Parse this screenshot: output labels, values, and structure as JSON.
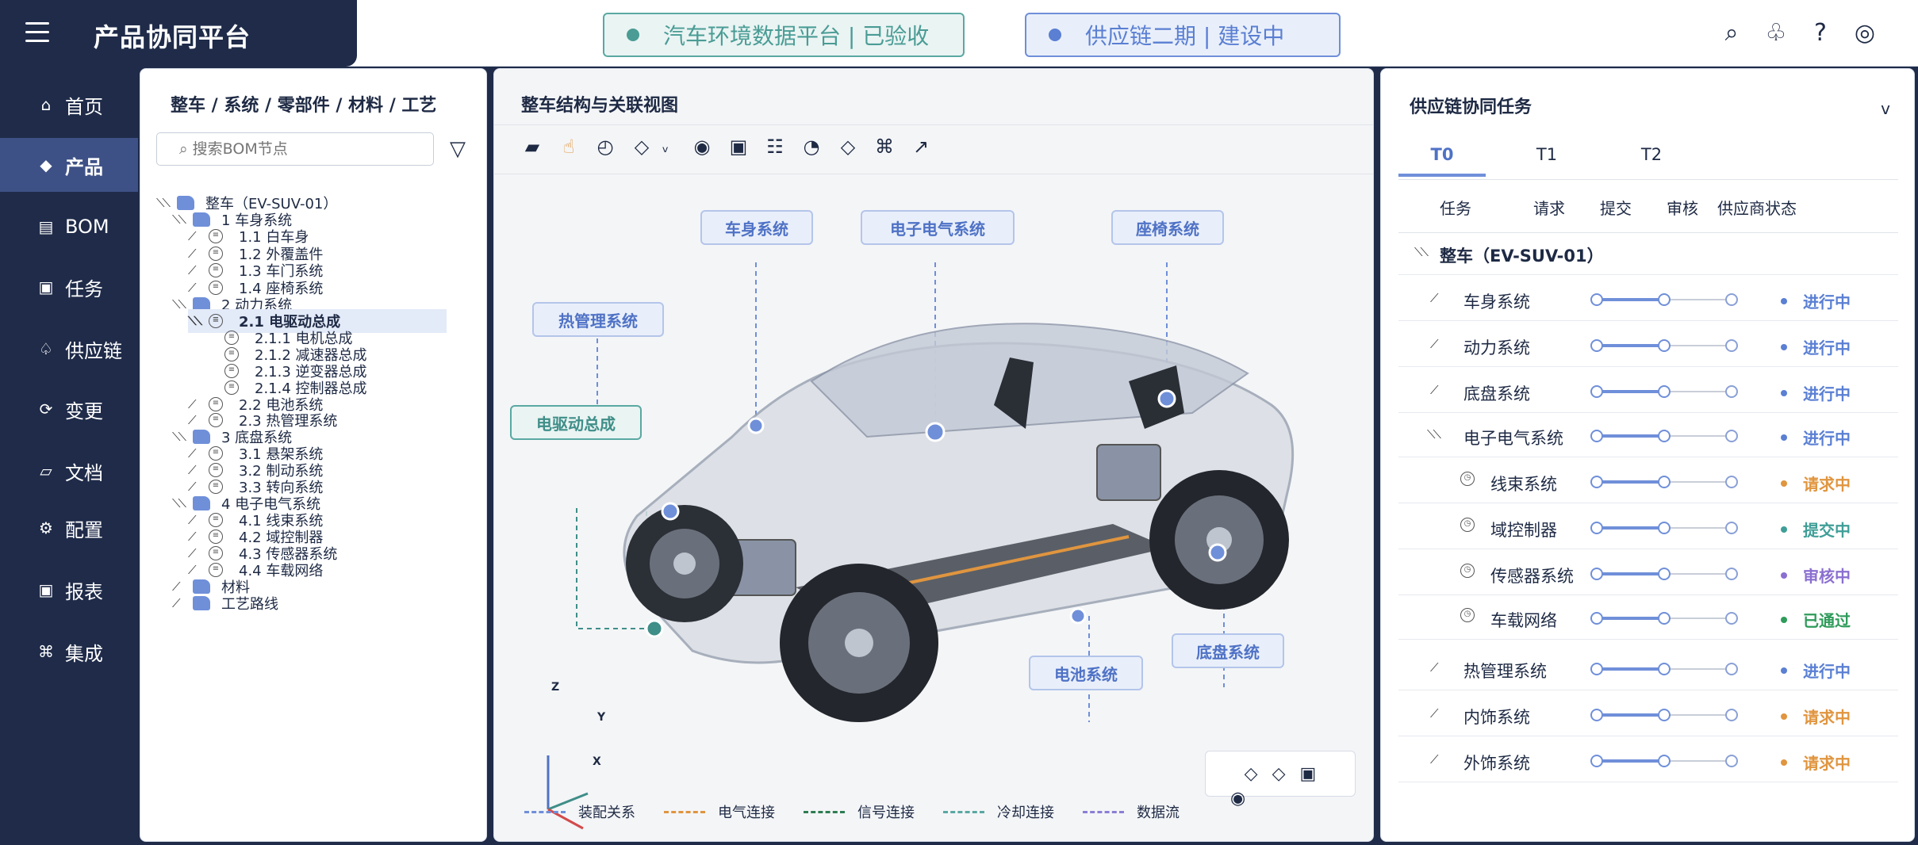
{
  "app": {
    "title": "产品协同平台",
    "pills": [
      {
        "label": "汽车环境数据平台 | 已验收"
      },
      {
        "label": "供应链二期 | 建设中"
      }
    ],
    "top_icons": [
      {
        "name": "search-icon",
        "glyph": "⌕"
      },
      {
        "name": "club-icon",
        "glyph": "♧"
      },
      {
        "name": "help-icon",
        "glyph": "?"
      },
      {
        "name": "target-icon",
        "glyph": "◎"
      }
    ]
  },
  "nav": {
    "items": [
      {
        "label": "首页",
        "icon": "⌂"
      },
      {
        "label": "产品",
        "icon": "◆"
      },
      {
        "label": "BOM",
        "icon": "▤"
      },
      {
        "label": "任务",
        "icon": "▣"
      },
      {
        "label": "供应链",
        "icon": "♤"
      },
      {
        "label": "变更",
        "icon": "⟳"
      },
      {
        "label": "文档",
        "icon": "▱"
      },
      {
        "label": "配置",
        "icon": "⚙"
      },
      {
        "label": "报表",
        "icon": "▣"
      },
      {
        "label": "集成",
        "icon": "⌘"
      }
    ]
  },
  "tree": {
    "title": "整车 / 系统 / 零部件 / 材料 / 工艺",
    "search_placeholder": "⌕ 搜索BOM节点",
    "filter_icon": "▽",
    "items": [
      {
        "label": "整车（EV-SUV-01）",
        "type": "folder",
        "toggle": "⟍⟍"
      },
      {
        "label": "1 车身系统",
        "type": "folder",
        "toggle": "⟍⟍"
      },
      {
        "label": "1.1 白车身",
        "type": "doc",
        "toggle": "⟋"
      },
      {
        "label": "1.2 外覆盖件",
        "type": "doc",
        "toggle": "⟋"
      },
      {
        "label": "1.3 车门系统",
        "type": "doc",
        "toggle": "⟋"
      },
      {
        "label": "1.4 座椅系统",
        "type": "doc",
        "toggle": "⟋"
      },
      {
        "label": "2 动力系统",
        "type": "folder",
        "toggle": "⟍⟍"
      },
      {
        "label": "2.1 电驱动总成",
        "type": "doc",
        "toggle": "⟍⟍"
      },
      {
        "label": "2.1.1 电机总成",
        "type": "doc",
        "toggle": ""
      },
      {
        "label": "2.1.2 减速器总成",
        "type": "doc",
        "toggle": ""
      },
      {
        "label": "2.1.3 逆变器总成",
        "type": "doc",
        "toggle": ""
      },
      {
        "label": "2.1.4 控制器总成",
        "type": "doc",
        "toggle": ""
      },
      {
        "label": "2.2 电池系统",
        "type": "doc",
        "toggle": "⟋"
      },
      {
        "label": "2.3 热管理系统",
        "type": "doc",
        "toggle": "⟋"
      },
      {
        "label": "3 底盘系统",
        "type": "folder",
        "toggle": "⟍⟍"
      },
      {
        "label": "3.1 悬架系统",
        "type": "doc",
        "toggle": "⟋"
      },
      {
        "label": "3.2 制动系统",
        "type": "doc",
        "toggle": "⟋"
      },
      {
        "label": "3.3 转向系统",
        "type": "doc",
        "toggle": "⟋"
      },
      {
        "label": "4 电子电气系统",
        "type": "folder",
        "toggle": "⟍⟍"
      },
      {
        "label": "4.1 线束系统",
        "type": "doc",
        "toggle": "⟋"
      },
      {
        "label": "4.2 域控制器",
        "type": "doc",
        "toggle": "⟋"
      },
      {
        "label": "4.3 传感器系统",
        "type": "doc",
        "toggle": "⟋"
      },
      {
        "label": "4.4 车载网络",
        "type": "doc",
        "toggle": "⟋"
      },
      {
        "label": "材料",
        "type": "folder",
        "toggle": "⟋"
      },
      {
        "label": "工艺路线",
        "type": "folder",
        "toggle": "⟋"
      }
    ],
    "selected_index": 7
  },
  "view": {
    "title": "整车结构与关联视图",
    "toolbar": [
      {
        "name": "box-tool-icon",
        "glyph": "▰"
      },
      {
        "name": "hand-tool-icon",
        "glyph": "☝"
      },
      {
        "name": "clock-tool-icon",
        "glyph": "◴"
      },
      {
        "name": "diamond-tool-icon",
        "glyph": "◇"
      },
      {
        "name": "dropdown-tool-icon",
        "glyph": "ᵥ"
      },
      {
        "name": "radio-tool-icon",
        "glyph": "◉"
      },
      {
        "name": "square-tool-icon",
        "glyph": "▣"
      },
      {
        "name": "list-tool-icon",
        "glyph": "☷"
      },
      {
        "name": "pie-tool-icon",
        "glyph": "◔"
      },
      {
        "name": "diamond2-tool-icon",
        "glyph": "◇"
      },
      {
        "name": "command-tool-icon",
        "glyph": "⌘"
      },
      {
        "name": "arrow-tool-icon",
        "glyph": "↗"
      }
    ],
    "callouts": [
      {
        "label": "车身系统"
      },
      {
        "label": "电子电气系统"
      },
      {
        "label": "座椅系统"
      },
      {
        "label": "热管理系统"
      },
      {
        "label": "电驱动总成"
      },
      {
        "label": "电池系统"
      },
      {
        "label": "底盘系统"
      }
    ],
    "axes": {
      "z": "Z",
      "y": "Y",
      "x": "X"
    },
    "mini_tools": [
      {
        "name": "diamond-small-icon",
        "glyph": "◇"
      },
      {
        "name": "diamond-small2-icon",
        "glyph": "◇"
      },
      {
        "name": "square-small-icon",
        "glyph": "▣"
      }
    ],
    "mini_dot": "◉",
    "legend": [
      {
        "label": "装配关系",
        "color": "#6f8fd9"
      },
      {
        "label": "电气连接",
        "color": "#e0953f"
      },
      {
        "label": "信号连接",
        "color": "#2e7d52"
      },
      {
        "label": "冷却连接",
        "color": "#5aa8a2"
      },
      {
        "label": "数据流",
        "color": "#8a7fd6"
      }
    ]
  },
  "tasks": {
    "title": "供应链协同任务",
    "collapse_icon": "v",
    "tabs": [
      {
        "label": "T0"
      },
      {
        "label": "T1"
      },
      {
        "label": "T2"
      }
    ],
    "columns": [
      "任务",
      "请求",
      "提交",
      "审核",
      "供应商状态"
    ],
    "root": {
      "label": "整车（EV-SUV-01）",
      "toggle": "⟍⟍"
    },
    "rows": [
      {
        "label": "车身系统",
        "toggle": "⟋",
        "status": "进行中",
        "tone": "blue",
        "sub": false
      },
      {
        "label": "动力系统",
        "toggle": "⟋",
        "status": "进行中",
        "tone": "blue",
        "sub": false
      },
      {
        "label": "底盘系统",
        "toggle": "⟋",
        "status": "进行中",
        "tone": "blue",
        "sub": false
      },
      {
        "label": "电子电气系统",
        "toggle": "⟍⟍",
        "status": "进行中",
        "tone": "blue",
        "sub": false
      },
      {
        "label": "线束系统",
        "toggle": "",
        "status": "请求中",
        "tone": "orange",
        "sub": true
      },
      {
        "label": "域控制器",
        "toggle": "",
        "status": "提交中",
        "tone": "teal",
        "sub": true
      },
      {
        "label": "传感器系统",
        "toggle": "",
        "status": "审核中",
        "tone": "purple",
        "sub": true
      },
      {
        "label": "车载网络",
        "toggle": "",
        "status": "已通过",
        "tone": "green",
        "sub": true
      },
      {
        "label": "热管理系统",
        "toggle": "⟋",
        "status": "进行中",
        "tone": "blue",
        "sub": false
      },
      {
        "label": "内饰系统",
        "toggle": "⟋",
        "status": "请求中",
        "tone": "orange",
        "sub": false
      },
      {
        "label": "外饰系统",
        "toggle": "⟋",
        "status": "请求中",
        "tone": "orange",
        "sub": false
      }
    ]
  }
}
